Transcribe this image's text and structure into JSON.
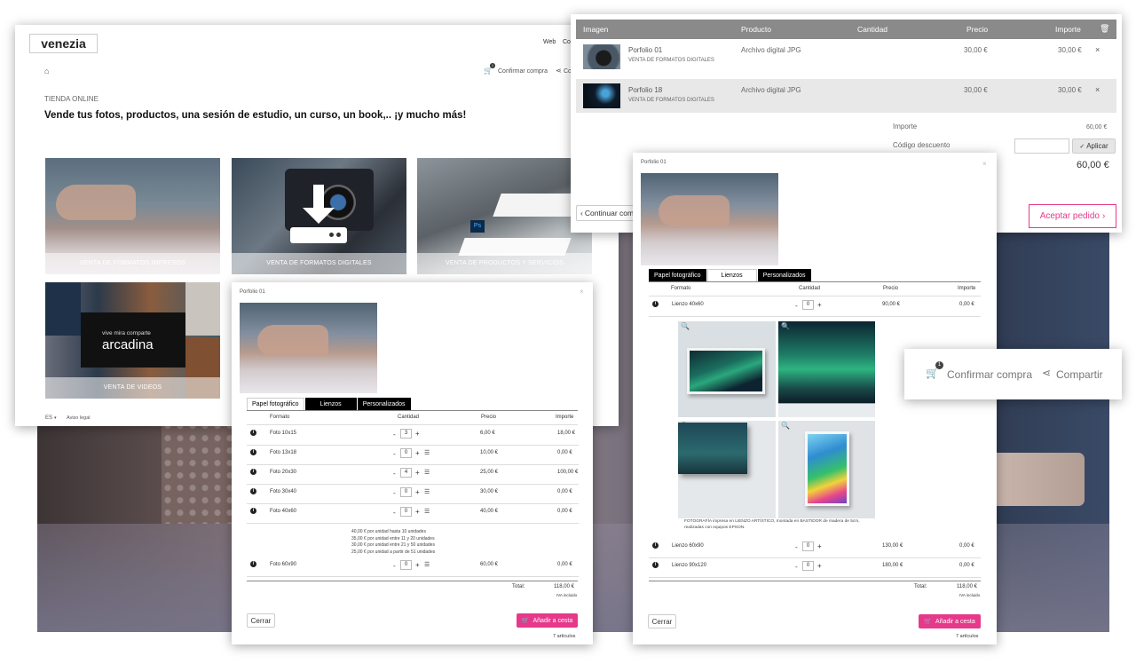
{
  "site": {
    "logo": "venezia",
    "nav": [
      "Web",
      "Co"
    ],
    "confirm_label": "Confirmar compra",
    "share_label": "Co",
    "cart_count": "1",
    "section_small": "TIENDA ONLINE",
    "headline": "Vende tus fotos, productos, una sesión de estudio, un curso, un book,.. ¡y mucho más!",
    "tiles": [
      "VENTA DE FORMATOS IMPRESOS",
      "VENTA DE FORMATOS DIGITALES",
      "VENTA DE PRODUCTOS Y SERVICIOS",
      "VENTA DE VIDEOS"
    ],
    "tile_overlay_top": "vive mira comparte",
    "tile_overlay_word": "arcadina",
    "lang": "ES",
    "legal": "Aviso legal"
  },
  "cart": {
    "headers": [
      "Imagen",
      "Producto",
      "Cantidad",
      "Precio",
      "Importe"
    ],
    "rows": [
      {
        "name": "Porfolio 01",
        "sub": "VENTA DE FORMATOS DIGITALES",
        "product": "Archivo digital JPG",
        "price": "30,00 €",
        "amount": "30,00 €"
      },
      {
        "name": "Porfolio 18",
        "sub": "VENTA DE FORMATOS DIGITALES",
        "product": "Archivo digital JPG",
        "price": "30,00 €",
        "amount": "30,00 €"
      }
    ],
    "importe_label": "Importe",
    "importe_value": "60,00 €",
    "discount_label": "Código descuento",
    "apply_label": "Aplicar",
    "total_value": "60,00 €",
    "continue_label": "Continuar com",
    "accept_label": "Aceptar pedido"
  },
  "modal_left": {
    "title": "Porfolio 01",
    "tabs": [
      "Papel fotográfico",
      "Lienzos",
      "Personalizados"
    ],
    "headers": [
      "Formato",
      "Cantidad",
      "Precio",
      "Importe"
    ],
    "rows": [
      {
        "name": "Foto 10x15",
        "qty": "3",
        "price": "6,00 €",
        "amount": "18,00 €"
      },
      {
        "name": "Foto 13x18",
        "qty": "0",
        "price": "10,00 €",
        "amount": "0,00 €"
      },
      {
        "name": "Foto 20x30",
        "qty": "4",
        "price": "25,00 €",
        "amount": "100,00 €"
      },
      {
        "name": "Foto 30x40",
        "qty": "0",
        "price": "30,00 €",
        "amount": "0,00 €"
      },
      {
        "name": "Foto 40x60",
        "qty": "0",
        "price": "40,00 €",
        "amount": "0,00 €"
      },
      {
        "name": "Foto 60x90",
        "qty": "0",
        "price": "60,00 €",
        "amount": "0,00 €"
      }
    ],
    "discounts": [
      "40,00 € por unidad hasta 10 unidades",
      "35,00 € por unidad entre 11 y 20 unidades",
      "30,00 € por unidad entre 21 y 50 unidades",
      "25,00 € por unidad a partir de 51 unidades"
    ],
    "total_label": "Total:",
    "total_value": "118,00 €",
    "iva": "IVA incluido",
    "close_label": "Cerrar",
    "add_label": "Añadir a cesta",
    "articles": "7 artículos"
  },
  "modal_right": {
    "title": "Porfolio 01",
    "tabs": [
      "Papel fotográfico",
      "Lienzos",
      "Personalizados"
    ],
    "headers": [
      "Formato",
      "Cantidad",
      "Precio",
      "Importe"
    ],
    "rows": [
      {
        "name": "Lienzo 40x60",
        "qty": "0",
        "price": "90,00 €",
        "amount": "0,00 €"
      },
      {
        "name": "Lienzo 60x90",
        "qty": "0",
        "price": "130,00 €",
        "amount": "0,00 €"
      },
      {
        "name": "Lienzo 90x120",
        "qty": "0",
        "price": "180,00 €",
        "amount": "0,00 €"
      }
    ],
    "caption": "FOTOGRAFÍA impresa en LIENZO ARTÍSTICO, montada en BASTIDOR de madera de 5cm, realizadas con equipos EPSON.",
    "total_label": "Total:",
    "total_value": "118,00 €",
    "iva": "IVA incluido",
    "close_label": "Cerrar",
    "add_label": "Añadir a cesta",
    "articles": "7 artículos"
  },
  "callout": {
    "badge": "1",
    "confirm_label": "Confirmar compra",
    "share_label": "Compartir"
  },
  "colors": {
    "accent": "#e6398b",
    "header_gray": "#8a8a8a"
  }
}
